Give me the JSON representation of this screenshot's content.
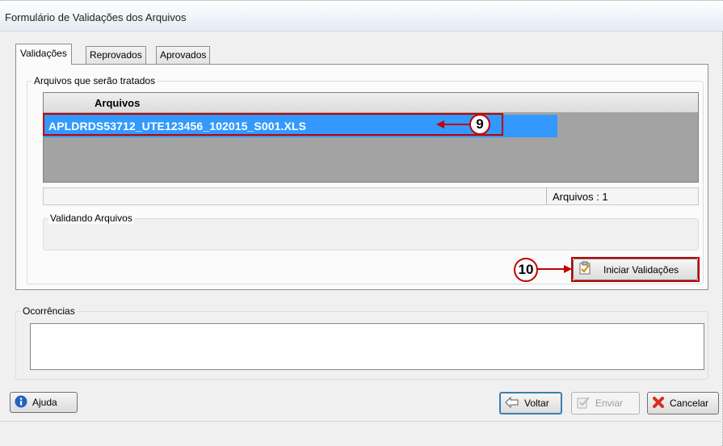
{
  "window": {
    "title": "Formulário de Validações dos Arquivos"
  },
  "tabs": [
    {
      "label": "Validações",
      "active": true
    },
    {
      "label": "Reprovados",
      "active": false
    },
    {
      "label": "Aprovados",
      "active": false
    }
  ],
  "files_group": {
    "label": "Arquivos que serão tratados"
  },
  "grid": {
    "column_header": "Arquivos",
    "rows": [
      "APLDRDS53712_UTE123456_102015_S001.XLS"
    ]
  },
  "status": {
    "count_text": "Arquivos : 1"
  },
  "validating_group": {
    "label": "Validando Arquivos"
  },
  "start_button": {
    "label": "Iniciar Validações",
    "icon": "checklist-icon"
  },
  "occurrences_group": {
    "label": "Ocorrências",
    "value": ""
  },
  "footer": {
    "help_label": "Ajuda",
    "back_label": "Voltar",
    "send_label": "Enviar",
    "cancel_label": "Cancelar"
  },
  "annotations": {
    "callout_9": "9",
    "callout_10": "10"
  },
  "colors": {
    "selection": "#3399ff",
    "annotation": "#c00000"
  }
}
